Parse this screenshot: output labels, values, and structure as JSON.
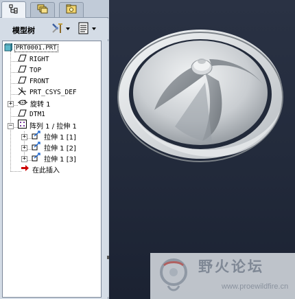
{
  "navigator": {
    "tabs": [
      {
        "name": "model-tree-tab",
        "icon": "model-tree-icon",
        "active": true
      },
      {
        "name": "folder-browser-tab",
        "icon": "folder-stack-icon",
        "active": false
      },
      {
        "name": "favorites-tab",
        "icon": "favorites-folder-icon",
        "active": false
      }
    ],
    "tree_title": "模型树",
    "settings_icon": "tools-settings-icon",
    "show_icon": "show-list-icon"
  },
  "tree": {
    "root": "PRT0001.PRT",
    "items": [
      {
        "label": "RIGHT",
        "icon": "datum-plane-icon"
      },
      {
        "label": "TOP",
        "icon": "datum-plane-icon"
      },
      {
        "label": "FRONT",
        "icon": "datum-plane-icon"
      },
      {
        "label": "PRT_CSYS_DEF",
        "icon": "coordinate-system-icon"
      },
      {
        "label": "旋转 1",
        "icon": "revolve-icon"
      },
      {
        "label": "DTM1",
        "icon": "datum-plane-icon"
      },
      {
        "label": "阵列 1 / 拉伸 1",
        "icon": "pattern-icon"
      },
      {
        "label": "拉伸 1 [1]",
        "icon": "extrude-icon"
      },
      {
        "label": "拉伸 1 [2]",
        "icon": "extrude-icon"
      },
      {
        "label": "拉伸 1 [3]",
        "icon": "extrude-icon"
      },
      {
        "label": "在此插入",
        "icon": "insert-here-arrow-icon"
      }
    ]
  },
  "watermark": {
    "title": "野火论坛",
    "url": "www.proewildfire.cn"
  },
  "colors": {
    "viewport_background": "#232b3c",
    "model_surface": "#dfe3e6",
    "insert_arrow": "#cc0000"
  }
}
